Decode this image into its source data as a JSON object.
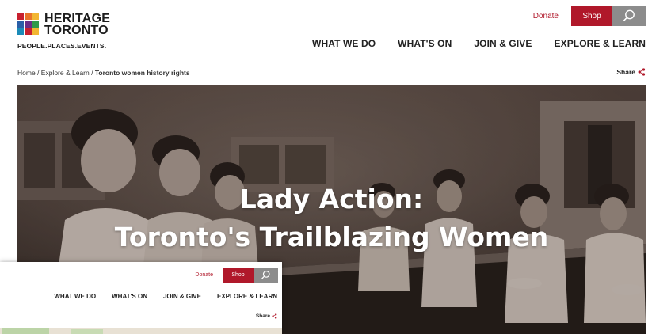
{
  "brand": {
    "name_line1": "HERITAGE",
    "name_line2": "TORONTO",
    "tagline": "PEOPLE.PLACES.EVENTS.",
    "logo_colors": [
      "#c8202f",
      "#e8742a",
      "#f2b632",
      "#2a5fa8",
      "#6b2d87",
      "#2f9a4a",
      "#1b8bb8",
      "#c8202f",
      "#f2b632"
    ]
  },
  "topbar": {
    "donate_label": "Donate",
    "shop_label": "Shop",
    "search_icon": "search-icon",
    "accent_color": "#b0182a"
  },
  "nav": {
    "items": [
      {
        "label": "WHAT WE DO"
      },
      {
        "label": "WHAT'S ON"
      },
      {
        "label": "JOIN & GIVE"
      },
      {
        "label": "EXPLORE & LEARN"
      }
    ]
  },
  "breadcrumb": {
    "home": "Home",
    "separator": " / ",
    "section": "Explore & Learn",
    "current": "Toronto women history rights"
  },
  "share_label": "Share",
  "hero": {
    "title_line1": "Lady Action:",
    "title_line2": "Toronto's Trailblazing Women"
  },
  "inset": {
    "donate_label": "Donate",
    "shop_label": "Shop",
    "nav": [
      "WHAT WE DO",
      "WHAT'S ON",
      "JOIN & GIVE",
      "EXPLORE & LEARN"
    ],
    "share_label": "Share"
  }
}
